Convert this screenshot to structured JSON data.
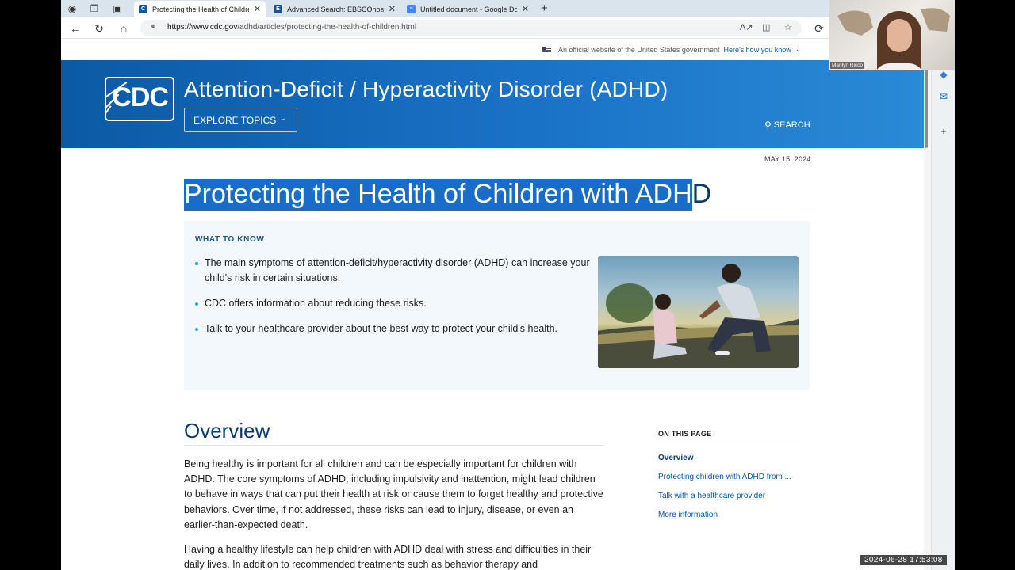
{
  "browser": {
    "tabs": [
      {
        "label": "Protecting the Health of Children",
        "favicon": "CDC",
        "active": true
      },
      {
        "label": "Advanced Search: EBSCOhost",
        "favicon": "E",
        "active": false
      },
      {
        "label": "Untitled document - Google Doc",
        "favicon": "doc",
        "active": false
      }
    ],
    "url_host": "https://www.cdc.gov",
    "url_path": "/adhd/articles/protecting-the-health-of-children.html"
  },
  "gov_banner": {
    "text": "An official website of the United States government",
    "link": "Here's how you know"
  },
  "header": {
    "logo_text": "CDC",
    "site_title": "Attention-Deficit / Hyperactivity Disorder (ADHD)",
    "explore_label": "EXPLORE TOPICS",
    "search_label": "SEARCH"
  },
  "article": {
    "date": "MAY 15, 2024",
    "title_selected": "Protecting the Health of Children with ADH",
    "title_rest": "D",
    "what_to_know": {
      "heading": "WHAT TO KNOW",
      "items": [
        "The main symptoms of attention-deficit/hyperactivity disorder (ADHD) can increase your child's risk in certain situations.",
        "CDC offers information about reducing these risks.",
        "Talk to your healthcare provider about the best way to protect your child's health."
      ]
    },
    "overview_heading": "Overview",
    "paragraphs": [
      "Being healthy is important for all children and can be especially important for children with ADHD. The core symptoms of ADHD, including impulsivity and inattention, might lead children to behave in ways that can put their health at risk or cause them to forget healthy and protective behaviors. Over time, if not addressed, these risks can lead to injury, disease, or even an earlier-than-expected death.",
      "Having a healthy lifestyle can help children with ADHD deal with stress and difficulties in their daily lives. In addition to recommended treatments such as behavior therapy and"
    ]
  },
  "on_this_page": {
    "heading": "ON THIS PAGE",
    "links": [
      "Overview",
      "Protecting children with ADHD from ...",
      "Talk with a healthcare provider",
      "More information"
    ]
  },
  "webcam": {
    "name": "Marilyn Ricco"
  },
  "recording_timestamp": "2024-06-28  17:53:08"
}
